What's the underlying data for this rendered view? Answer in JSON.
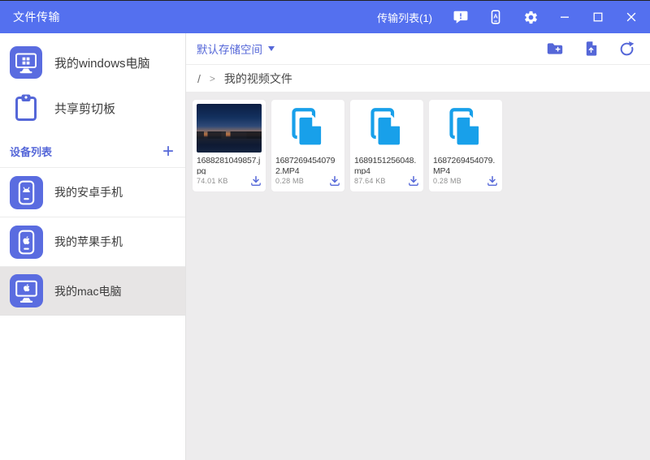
{
  "colors": {
    "titlebar": "#5470ef",
    "accent": "#5567d8",
    "icon-bg": "#5a6ce0",
    "file-blue": "#18a0ea",
    "content-bg": "#edeced",
    "selected-bg": "#e7e5e5"
  },
  "titlebar": {
    "app_title": "文件传输",
    "transfer_list": "传输列表(1)",
    "icons": [
      "feedback-icon",
      "device-screen-icon",
      "settings-gear-icon",
      "minimize-icon",
      "maximize-icon",
      "close-icon"
    ]
  },
  "sidebar": {
    "items": [
      {
        "icon": "windows-computer-icon",
        "label": "我的windows电脑"
      },
      {
        "icon": "clipboard-icon",
        "label": "共享剪切板"
      }
    ],
    "device_header": "设备列表",
    "add_button": "+",
    "devices": [
      {
        "icon": "android-phone-icon",
        "label": "我的安卓手机",
        "selected": false
      },
      {
        "icon": "apple-phone-icon",
        "label": "我的苹果手机",
        "selected": false
      },
      {
        "icon": "mac-computer-icon",
        "label": "我的mac电脑",
        "selected": true
      }
    ]
  },
  "toolbar": {
    "storage_space": "默认存储空间",
    "actions": [
      "new-folder-icon",
      "upload-file-icon",
      "refresh-icon"
    ]
  },
  "breadcrumb": {
    "root": "/",
    "separator": ">",
    "current": "我的视频文件"
  },
  "files": [
    {
      "name": "1688281049857.jpg",
      "size": "74.01 KB",
      "type": "image"
    },
    {
      "name": "16872694540792.MP4",
      "size": "0.28 MB",
      "type": "file"
    },
    {
      "name": "1689151256048.mp4",
      "size": "87.64 KB",
      "type": "file"
    },
    {
      "name": "1687269454079.MP4",
      "size": "0.28 MB",
      "type": "file"
    }
  ]
}
